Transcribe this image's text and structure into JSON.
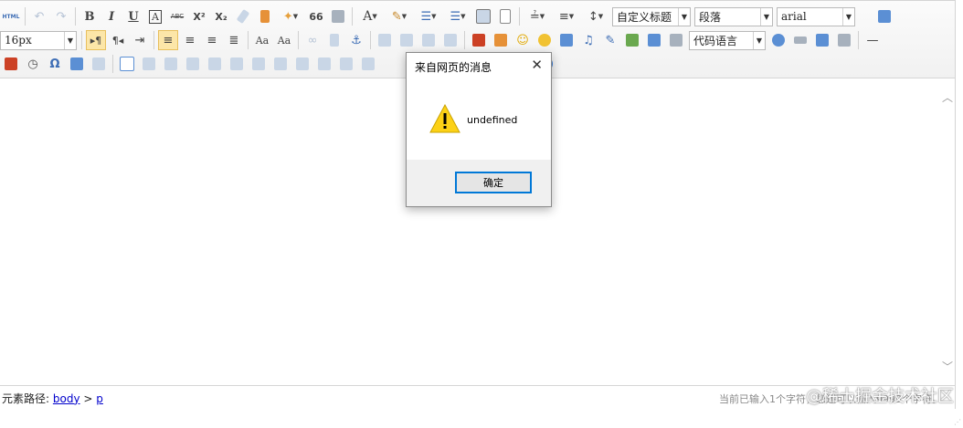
{
  "toolbar": {
    "row1": [
      "html-source-button",
      "undo-button",
      "redo-button",
      "bold-button",
      "italic-button",
      "underline-button",
      "font-border-button",
      "strikethrough-button",
      "superscript-button",
      "subscript-button",
      "eraser-button",
      "format-match-button",
      "auto-typeset-button",
      "blockquote-button",
      "paste-plain-button",
      "font-color-button",
      "highlight-color-button",
      "ordered-list-button",
      "unordered-list-button",
      "select-all-button",
      "clear-doc-button",
      "row-spacing-top-button",
      "row-spacing-bottom-button",
      "line-height-button"
    ],
    "bold_label": "B",
    "italic_label": "I",
    "underline_label": "U",
    "font_border_label": "A",
    "strike_label": "ABC",
    "superscript_label": "X²",
    "subscript_label": "X₂",
    "quote_label": "66",
    "font_color_label": "A",
    "custom_title": {
      "value": "自定义标题"
    },
    "paragraph": {
      "value": "段落"
    },
    "font_family": {
      "value": "arial"
    },
    "font_size": {
      "value": "16px"
    },
    "code_lang": {
      "value": "代码语言"
    },
    "html_label": "HTML",
    "omega_label": "Ω",
    "help_label": "?"
  },
  "status": {
    "path_label": "元素路径:",
    "path_body": "body",
    "path_sep": ">",
    "path_p": "p",
    "word_count": "当前已输入1个字符，您还可以输入9999个字符。"
  },
  "watermark": "@稀土掘金技术社区",
  "dialog": {
    "title": "来自网页的消息",
    "close": "✕",
    "message": "undefined",
    "ok_label": "确定"
  },
  "colors": {
    "accent": "#0078d7",
    "active_btn": "#fce6a8",
    "link": "#0000cc"
  }
}
